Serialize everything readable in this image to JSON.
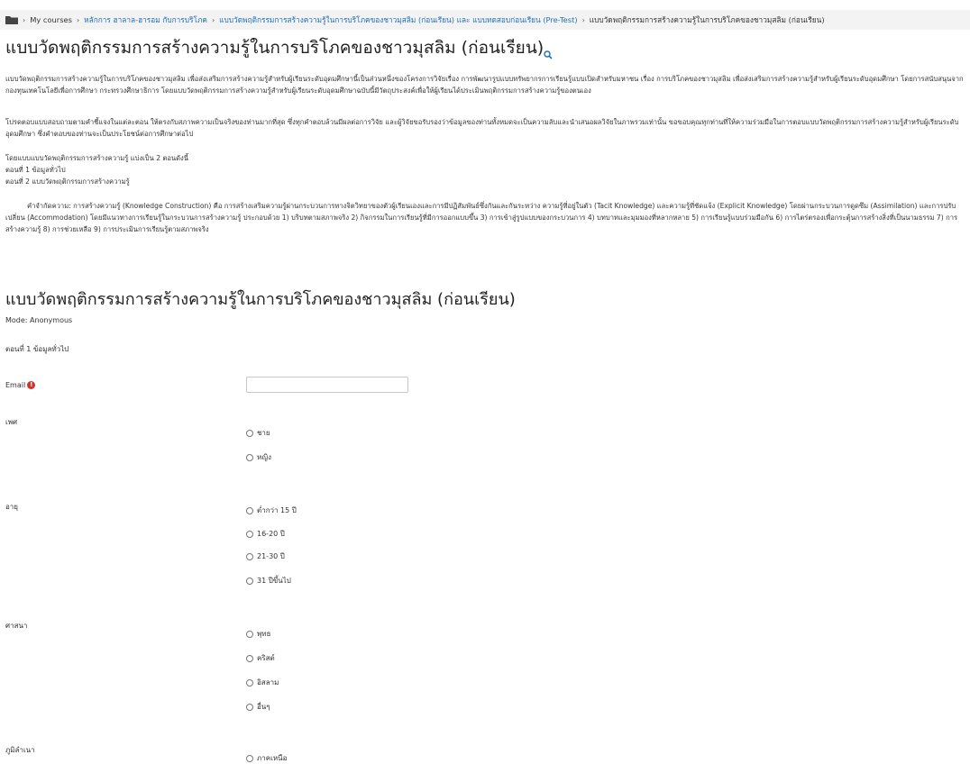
{
  "breadcrumb": {
    "items": [
      "My courses",
      "หลักการ ฮาลาล-ฮารอม กับการบริโภค",
      "แบบวัดพฤติกรรมการสร้างความรู้ในการบริโภคของชาวมุสลิม (ก่อนเรียน) และ แบบทดสอบก่อนเรียน (Pre-Test)",
      "แบบวัดพฤติกรรมการสร้างความรู้ในการบริโภคของชาวมุสลิม (ก่อนเรียน)"
    ]
  },
  "page": {
    "title": "แบบวัดพฤติกรรมการสร้างความรู้ในการบริโภคของชาวมุสลิม (ก่อนเรียน)"
  },
  "intro": {
    "p1": "แบบวัดพฤติกรรมการสร้างความรู้ในการบริโภคของชาวมุสลิม เพื่อส่งเสริมการสร้างความรู้สำหรับผู้เรียนระดับอุดมศึกษานี้เป็นส่วนหนึ่งของโครงการวิจัยเรื่อง การพัฒนารูปแบบทรัพยากรการเรียนรู้แบบเปิดสำหรับมหาชน เรื่อง การบริโภคของชาวมุสลิม เพื่อส่งเสริมการสร้างความรู้สำหรับผู้เรียนระดับอุดมศึกษา โดยการสนับสนุนจากกองทุนเทคโนโลยีเพื่อการศึกษา กระทรวงศึกษาธิการ โดยแบบวัดพฤติกรรมการสร้างความรู้สำหรับผู้เรียนระดับอุดมศึกษาฉบับนี้มีวัตถุประสงค์เพื่อให้ผู้เรียนได้ประเมินพฤติกรรมการสร้างความรู้ของตนเอง",
    "p2": "โปรดตอบแบบสอบถามตามคำชี้แจงในแต่ละตอน ให้ตรงกับสภาพความเป็นจริงของท่านมากที่สุด ซึ่งทุกคำตอบล้วนมีผลต่อการวิจัย และผู้วิจัยขอรับรองว่าข้อมูลของท่านทั้งหมดจะเป็นความลับและนำเสนอผลวิจัยในภาพรวมเท่านั้น ขอขอบคุณทุกท่านที่ให้ความร่วมมือในการตอบแบบวัดพฤติกรรมการสร้างความรู้สำหรับผู้เรียนระดับอุดมศึกษา ซึ่งคำตอบของท่านจะเป็นประโยชน์ต่อการศึกษาต่อไป",
    "p3_line1": "โดยแบบแบบวัดพฤติกรรมการสร้างความรู้ แบ่งเป็น 2 ตอนดังนี้",
    "p3_line2": "ตอนที่ 1 ข้อมูลทั่วไป",
    "p3_line3": "ตอนที่ 2 แบบวัดพฤติกรรมการสร้างความรู้",
    "p4": "คำจำกัดความ: การสร้างความรู้ (Knowledge Construction) คือ การสร้างเสริมความรู้ผ่านกระบวนการทางจิตวิทยาของตัวผู้เรียนเองและการมีปฏิสัมพันธ์ซึ่งกันและกันระหว่าง ความรู้ที่อยู่ในตัว (Tacit Knowledge) และความรู้ที่ชัดแจ้ง (Explicit Knowledge) โดยผ่านกระบวนการดูดซึม (Assimilation) และการปรับเปลี่ยน (Accommodation) โดยมีแนวทางการเรียนรู้ในกระบวนการสร้างความรู้ ประกอบด้วย 1) บริบทตามสภาพจริง 2) กิจกรรมในการเรียนรู้ที่มีการออกแบบขึ้น 3) การเข้าสู่รูปแบบของกระบวนการ 4) บทบาทและมุมมองที่หลากหลาย 5) การเรียนรู้แบบร่วมมือกัน 6) การไตร่ตรองเพื่อกระตุ้นการสร้างสิ่งที่เป็นนามธรรม 7) การสร้างความรู้ 8) การช่วยเหลือ 9) การประเมินการเรียนรู้ตามสภาพจริง"
  },
  "form": {
    "title": "แบบวัดพฤติกรรมการสร้างความรู้ในการบริโภคของชาวมุสลิม (ก่อนเรียน)",
    "mode": "Mode: Anonymous",
    "section1": "ตอนที่ 1 ข้อมูลทั่วไป",
    "email_label": "Email",
    "email_value": "",
    "gender_label": "เพศ",
    "gender_options": [
      "ชาย",
      "หญิง"
    ],
    "age_label": "อายุ",
    "age_options": [
      "ต่ำกว่า 15 ปี",
      "16-20 ปี",
      "21-30 ปี",
      "31 ปีขึ้นไป"
    ],
    "religion_label": "ศาสนา",
    "religion_options": [
      "พุทธ",
      "คริสต์",
      "อิสลาม",
      "อื่นๆ"
    ],
    "region_label": "ภูมิลำเนา",
    "region_options": [
      "ภาคเหนือ"
    ]
  },
  "colors": {
    "link": "#1f6fb6",
    "required": "#d9302c",
    "breadcrumb_bg": "#f3f3f3"
  }
}
